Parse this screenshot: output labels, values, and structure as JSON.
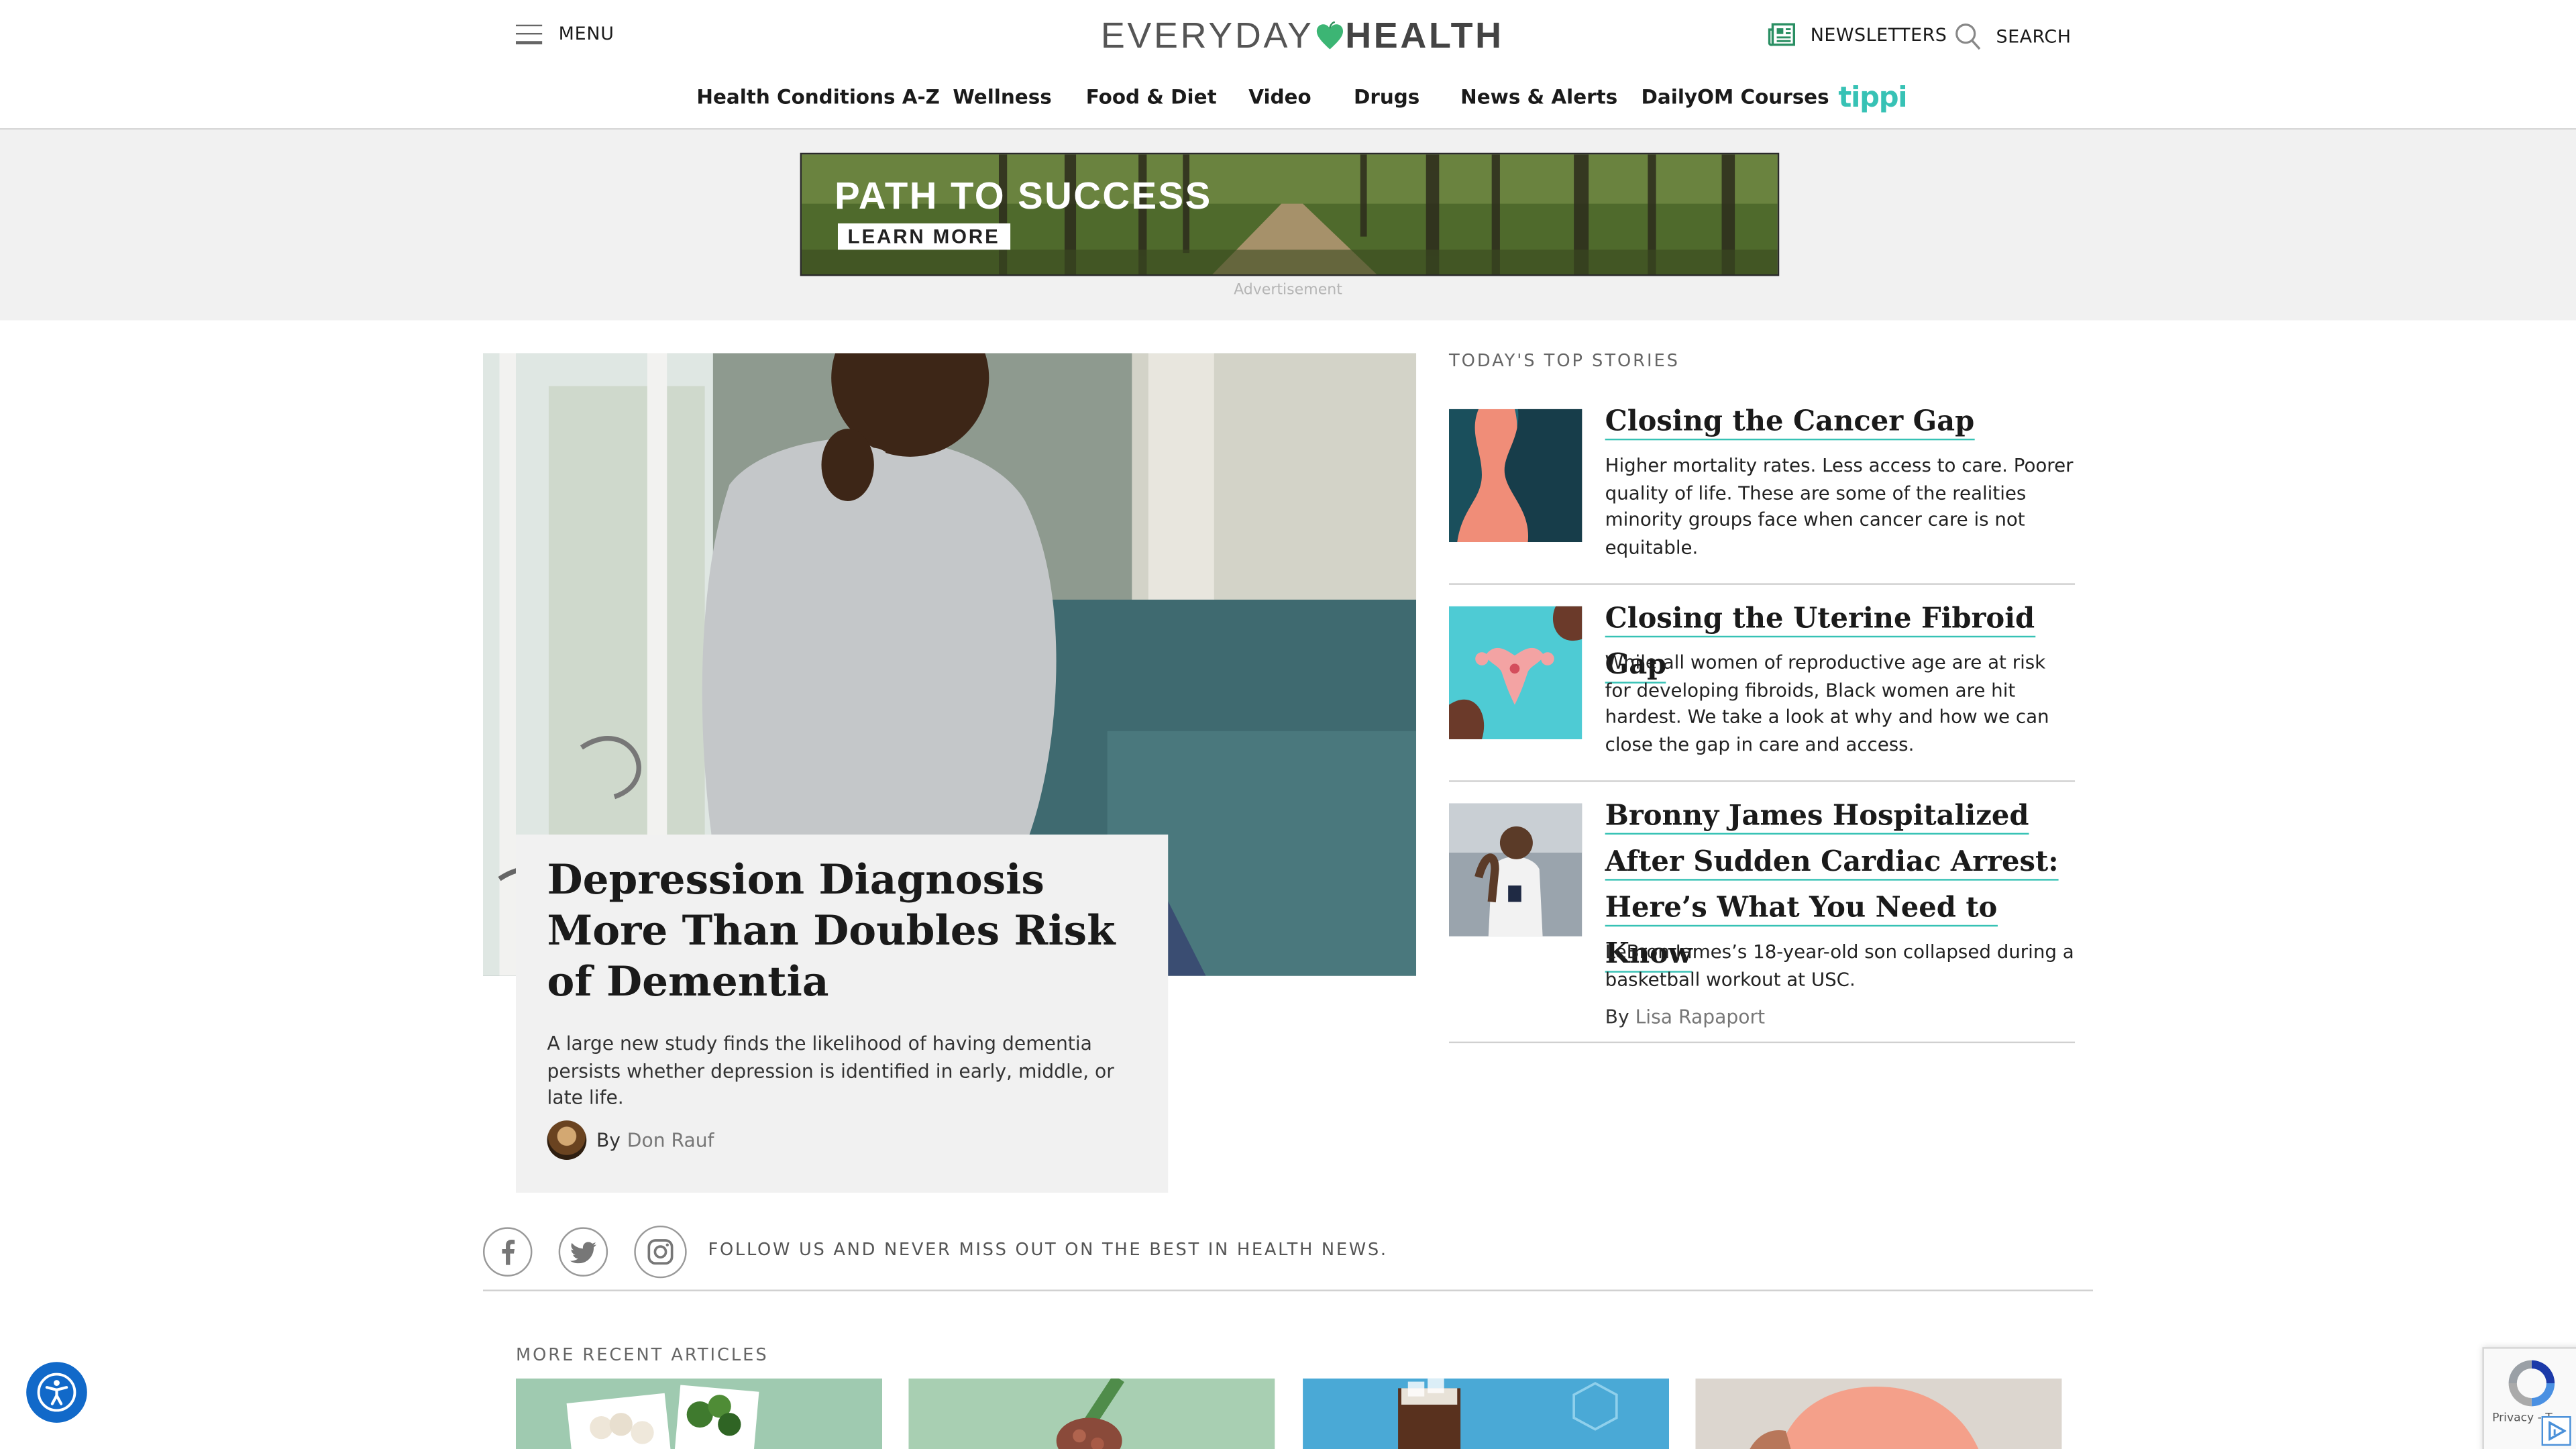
{
  "header": {
    "menu_label": "MENU",
    "logo": {
      "part1": "EVERYDAY",
      "part2": "HEALTH"
    },
    "newsletters_label": "NEWSLETTERS",
    "search_label": "SEARCH",
    "nav": [
      "Health Conditions A-Z",
      "Wellness",
      "Food & Diet",
      "Video",
      "Drugs",
      "News & Alerts",
      "DailyOM Courses"
    ],
    "tippi_label": "tippi",
    "colors": {
      "accent": "#37c2b5",
      "logo_heart": "#3cb574"
    }
  },
  "ad": {
    "headline": "PATH TO SUCCESS",
    "cta": "LEARN MORE",
    "label": "Advertisement"
  },
  "hero": {
    "title": "Depression Diagnosis More Than Doubles Risk of Dementia",
    "dek": "A large new study finds the likelihood of having dementia persists whether depression is identified in early, middle, or late life.",
    "by": "By",
    "author": "Don Rauf"
  },
  "top_stories": {
    "heading": "TODAY'S TOP STORIES",
    "items": [
      {
        "title": "Closing the Cancer Gap",
        "dek": "Higher mortality rates. Less access to care. Poorer quality of life. These are some of the realities minority groups face when cancer care is not equitable."
      },
      {
        "title": "Closing the Uterine Fibroid Gap",
        "dek": "While all women of reproductive age are at risk for developing fibroids, Black women are hit hardest. We take a look at why and how we can close the gap in care and access."
      },
      {
        "title": "Bronny James Hospitalized After Sudden Cardiac Arrest: Here’s What You Need to Know",
        "dek": "LeBron James’s 18-year-old son collapsed during a basketball workout at USC.",
        "by": "By",
        "author": "Lisa Rapaport"
      }
    ]
  },
  "follow": {
    "text": "FOLLOW US AND NEVER MISS OUT ON THE BEST IN HEALTH NEWS.",
    "icons": [
      "facebook-icon",
      "twitter-icon",
      "instagram-icon"
    ]
  },
  "more_recent": {
    "heading": "MORE RECENT ARTICLES"
  },
  "recaptcha": {
    "links": "Privacy - T"
  }
}
